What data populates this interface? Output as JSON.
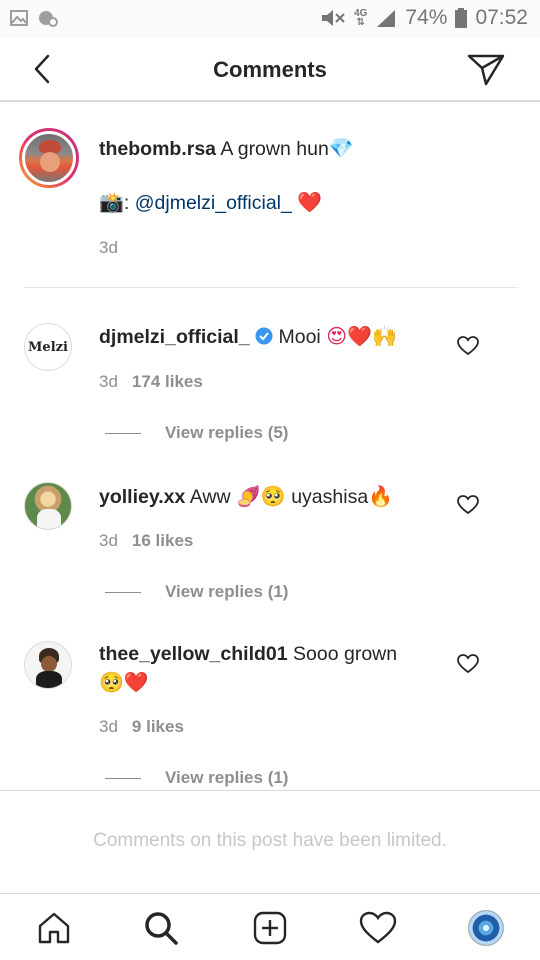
{
  "status_bar": {
    "network": "4G",
    "battery": "74%",
    "time": "07:52"
  },
  "header": {
    "title": "Comments"
  },
  "caption": {
    "username": "thebomb.rsa",
    "text": "A grown hun",
    "emoji": "💎",
    "camera_emoji": "📸",
    "credit_prefix": ": ",
    "mention": "@djmelzi_official_",
    "heart_emoji": "❤️",
    "time": "3d"
  },
  "comments": [
    {
      "username": "djmelzi_official_",
      "verified": true,
      "text": "Mooi",
      "emoji": "😍❤️🙌",
      "time": "3d",
      "likes": "174 likes",
      "replies": "View replies (5)",
      "avatar_text": "Melzi"
    },
    {
      "username": "yolliey.xx",
      "text": "Aww",
      "emoji_mid": "🍠🥺",
      "text2": "uyashisa",
      "emoji": "🔥",
      "time": "3d",
      "likes": "16 likes",
      "replies": "View replies (1)"
    },
    {
      "username": "thee_yellow_child01",
      "text": "Sooo grown",
      "emoji": "🥺❤️",
      "time": "3d",
      "likes": "9 likes",
      "replies": "View replies (1)"
    }
  ],
  "limited_notice": "Comments on this post have been limited.",
  "bottom_nav": {
    "items": [
      "home-icon",
      "search-icon",
      "new-post-icon",
      "activity-icon",
      "profile-avatar"
    ]
  },
  "colors": {
    "mention": "#003569",
    "verified": "#3897f0",
    "muted": "#8e8e8e",
    "ring_start": "#f9a825",
    "ring_end": "#c13584"
  }
}
